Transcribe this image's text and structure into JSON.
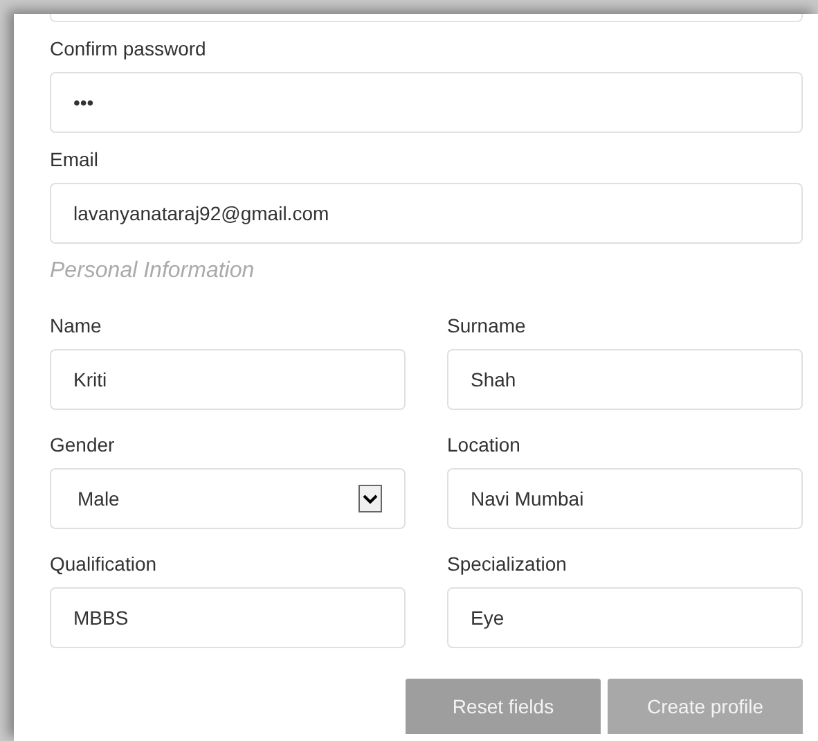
{
  "account_fields": [
    {
      "label": "Confirm password",
      "value": "•••"
    },
    {
      "label": "Email",
      "value": "lavanyanataraj92@gmail.com"
    }
  ],
  "section_title": "Personal Information",
  "personal_fields": [
    {
      "label": "Name",
      "value": "Kriti",
      "kind": "text"
    },
    {
      "label": "Surname",
      "value": "Shah",
      "kind": "text"
    },
    {
      "label": "Gender",
      "value": "Male",
      "kind": "select"
    },
    {
      "label": "Location",
      "value": "Navi Mumbai",
      "kind": "text"
    },
    {
      "label": "Qualification",
      "value": "MBBS",
      "kind": "text"
    },
    {
      "label": "Specialization",
      "value": "Eye",
      "kind": "text"
    }
  ],
  "buttons": [
    "Reset fields",
    "Create profile"
  ]
}
